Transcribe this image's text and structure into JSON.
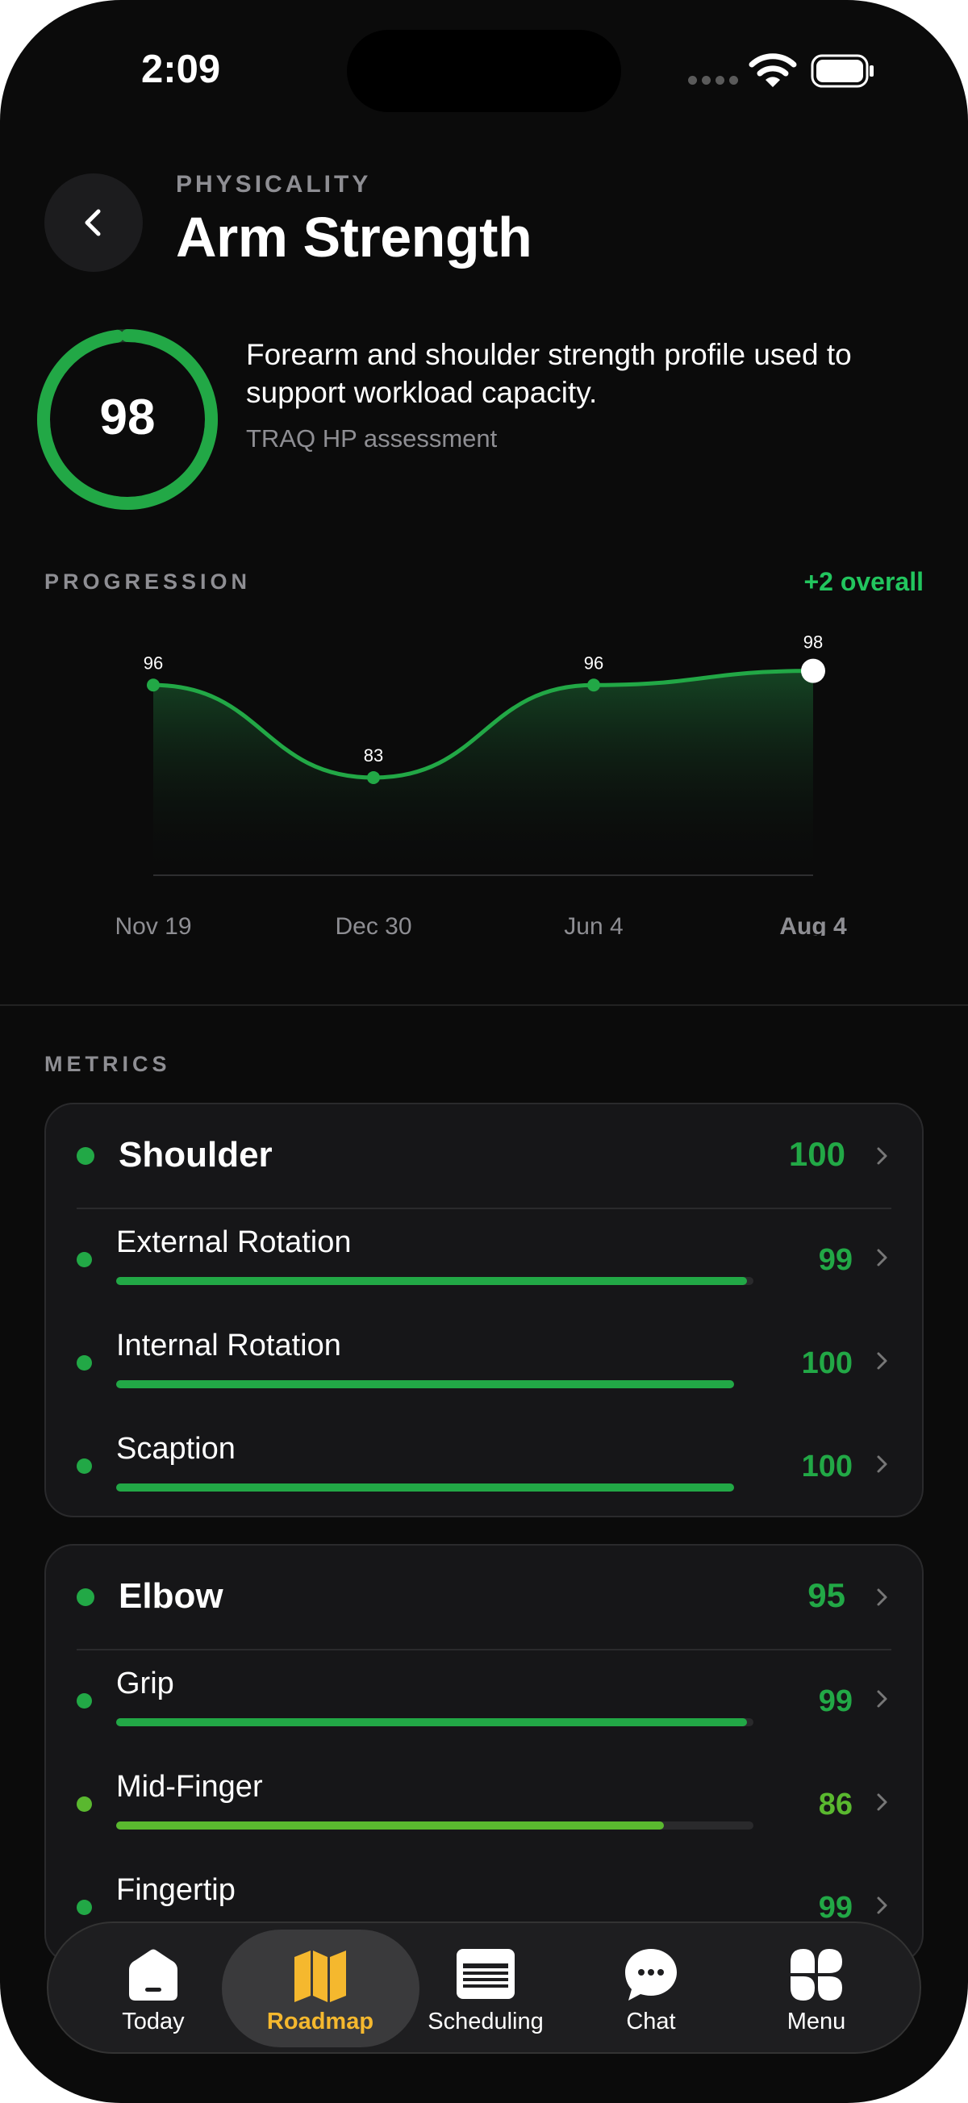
{
  "status_bar": {
    "time": "2:09"
  },
  "header": {
    "category": "PHYSICALITY",
    "title": "Arm Strength"
  },
  "summary": {
    "score": "98",
    "score_fraction": 0.98,
    "description": "Forearm and shoulder strength profile used to support workload capacity.",
    "source": "TRAQ HP assessment"
  },
  "progression": {
    "label": "PROGRESSION",
    "change": "+2 overall"
  },
  "chart_data": {
    "type": "line",
    "categories": [
      "Nov 19",
      "Dec 30",
      "Jun 4",
      "Aug 4"
    ],
    "values": [
      96,
      83,
      96,
      98
    ],
    "labels": [
      "96",
      "83",
      "96",
      "98"
    ],
    "ylim": [
      0,
      100
    ],
    "highlight_index": 3,
    "color": "#22c55e"
  },
  "metrics": {
    "label": "METRICS",
    "groups": [
      {
        "name": "Shoulder",
        "value": "100",
        "rows": [
          {
            "name": "External Rotation",
            "value": "99",
            "level": 0.99,
            "color": "#22a846"
          },
          {
            "name": "Internal Rotation",
            "value": "100",
            "level": 0.97,
            "color": "#22a846"
          },
          {
            "name": "Scaption",
            "value": "100",
            "level": 0.97,
            "color": "#22a846"
          }
        ]
      },
      {
        "name": "Elbow",
        "value": "95",
        "rows": [
          {
            "name": "Grip",
            "value": "99",
            "level": 0.99,
            "color": "#22a846"
          },
          {
            "name": "Mid-Finger",
            "value": "86",
            "level": 0.86,
            "color": "#5ab82f"
          },
          {
            "name": "Fingertip",
            "value": "99",
            "level": 0.99,
            "color": "#22a846"
          }
        ]
      }
    ]
  },
  "tabs": [
    {
      "label": "Today",
      "icon": "home-icon",
      "active": false
    },
    {
      "label": "Roadmap",
      "icon": "map-icon",
      "active": true
    },
    {
      "label": "Scheduling",
      "icon": "calendar-icon",
      "active": false
    },
    {
      "label": "Chat",
      "icon": "chat-icon",
      "active": false
    },
    {
      "label": "Menu",
      "icon": "grid-icon",
      "active": false
    }
  ],
  "colors": {
    "accent": "#22c55e",
    "active_tab": "#f5b82e",
    "background": "#0b0b0b"
  }
}
